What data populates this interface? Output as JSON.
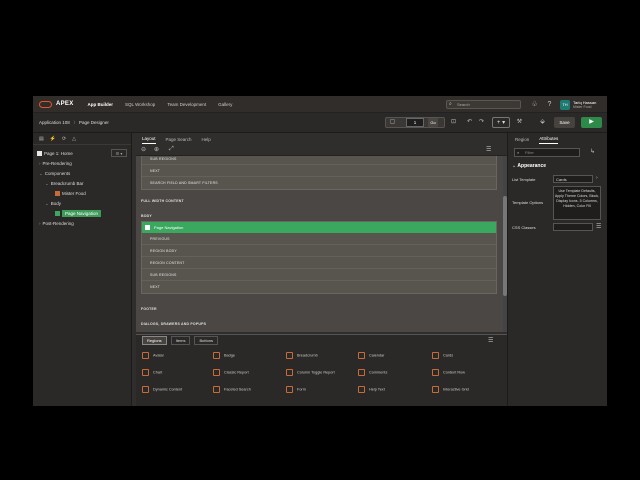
{
  "topbar": {
    "brand": "APEX",
    "nav": [
      "App Builder",
      "SQL Workshop",
      "Team Development",
      "Gallery"
    ],
    "search_placeholder": "Search",
    "user_initials": "TH",
    "user_name": "Tariq Hassan",
    "user_workspace": "Mister Food"
  },
  "bar2": {
    "app": "Application 108",
    "page": "Page Designer",
    "page_number": "1",
    "go": "Go",
    "save": "Save"
  },
  "left": {
    "tree": [
      {
        "label": "Page 1: Home",
        "indent": 0
      },
      {
        "label": "Pre-Rendering",
        "indent": 1
      },
      {
        "label": "Components",
        "indent": 1
      },
      {
        "label": "Breadcrumb Bar",
        "indent": 2
      },
      {
        "label": "Mister Food",
        "indent": 3
      },
      {
        "label": "Body",
        "indent": 2
      },
      {
        "label": "Page Navigation",
        "indent": 3
      },
      {
        "label": "Post-Rendering",
        "indent": 1
      }
    ]
  },
  "center": {
    "tabs": [
      "Layout",
      "Page Search",
      "Help"
    ],
    "top_region_rows": [
      "SUB REGIONS",
      "NEXT",
      "SEARCH FIELD AND SMART FILTERS"
    ],
    "section_full_width": "FULL WIDTH CONTENT",
    "section_body": "BODY",
    "page_nav_title": "Page Navigation",
    "page_nav_rows": [
      "PREVIOUS",
      "REGION BODY",
      "REGION CONTENT",
      "SUB REGIONS",
      "NEXT"
    ],
    "section_footer": "FOOTER",
    "section_dialogs": "DIALOGS, DRAWERS AND POPUPS"
  },
  "gallery": {
    "tabs": [
      "Regions",
      "Items",
      "Buttons"
    ],
    "items": [
      "Avatar",
      "Badge",
      "Breadcrumb",
      "Calendar",
      "Cards",
      "Chart",
      "Classic Report",
      "Column Toggle Report",
      "Comments",
      "Content Row",
      "Dynamic Content",
      "Faceted Search",
      "Form",
      "Help Text",
      "Interactive Grid"
    ]
  },
  "right": {
    "tabs": [
      "Region",
      "Attributes"
    ],
    "filter_placeholder": "Filter",
    "section": "Appearance",
    "list_template_label": "List Template",
    "list_template_value": "Cards",
    "template_options_label": "Template Options",
    "template_options_value": "Use Template Defaults, Apply Theme Colors, Block, Display Icons, 5 Columns, Hidden, Color Fill",
    "css_classes_label": "CSS Classes"
  },
  "colors": {
    "accent_green": "#3aa85e",
    "oracle_red": "#e3562b",
    "avatar_teal": "#1e7b72"
  }
}
